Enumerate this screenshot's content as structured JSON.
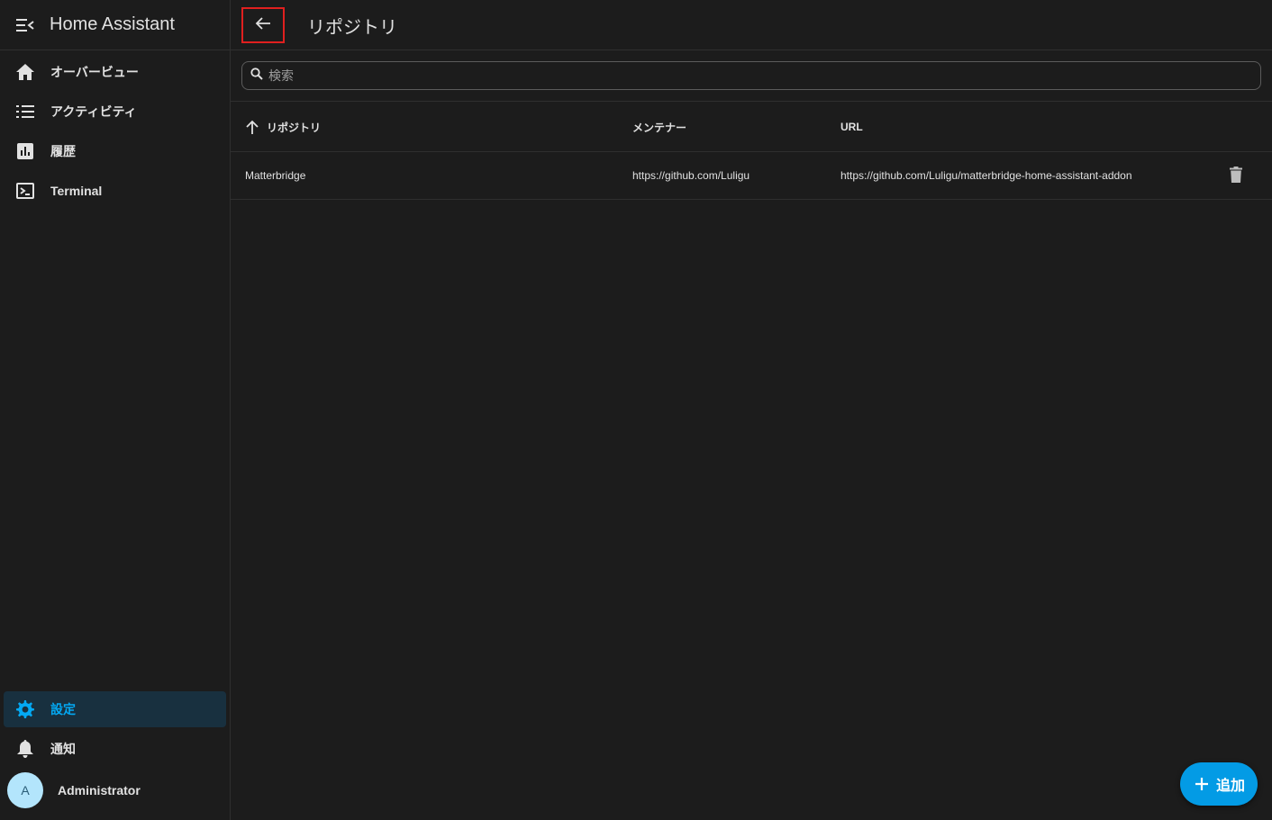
{
  "sidebar": {
    "title": "Home Assistant",
    "items": [
      {
        "label": "オーバービュー",
        "icon": "home-icon"
      },
      {
        "label": "アクティビティ",
        "icon": "list-icon"
      },
      {
        "label": "履歴",
        "icon": "chart-box-icon"
      },
      {
        "label": "Terminal",
        "icon": "console-icon"
      }
    ],
    "bottom": [
      {
        "label": "設定",
        "icon": "cog-icon",
        "active": true
      },
      {
        "label": "通知",
        "icon": "bell-icon"
      }
    ],
    "user": {
      "initial": "A",
      "name": "Administrator"
    }
  },
  "header": {
    "title": "リポジトリ"
  },
  "search": {
    "placeholder": "検索"
  },
  "table": {
    "columns": [
      "リポジトリ",
      "メンテナー",
      "URL"
    ],
    "rows": [
      {
        "name": "Matterbridge",
        "maintainer": "https://github.com/Luligu",
        "url": "https://github.com/Luligu/matterbridge-home-assistant-addon"
      }
    ]
  },
  "fab": {
    "label": "追加"
  },
  "colors": {
    "background": "#1c1c1c",
    "accent": "#03a9f4",
    "fab": "#039be5",
    "active_bg": "#18303f",
    "highlight_border": "#e0201f"
  }
}
